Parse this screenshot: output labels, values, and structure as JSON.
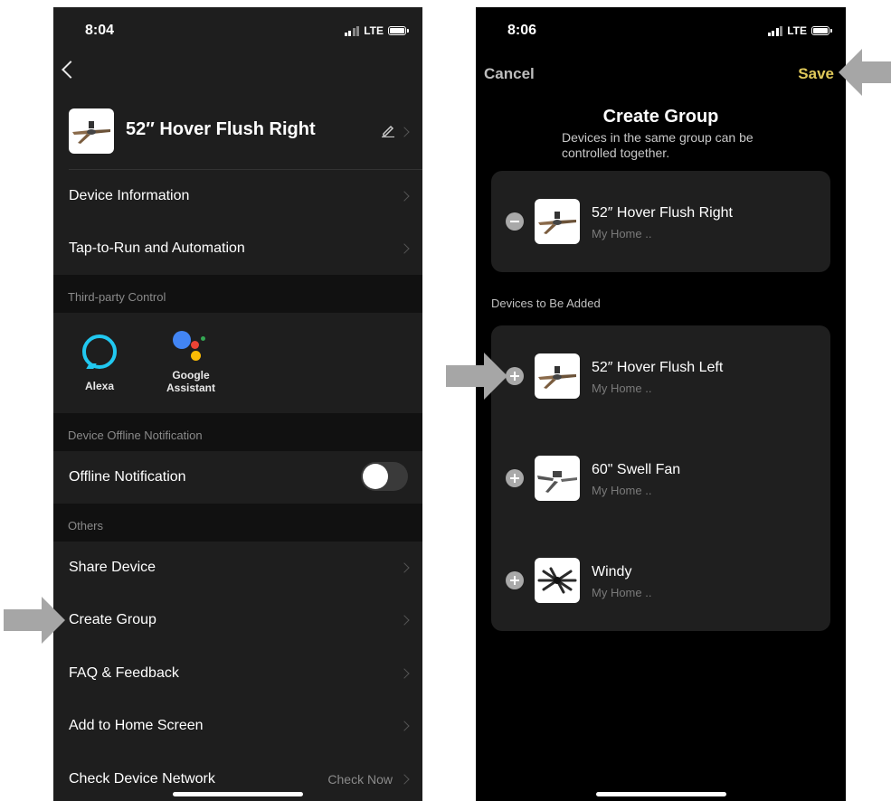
{
  "left": {
    "status": {
      "time": "8:04",
      "network": "LTE"
    },
    "device": {
      "title": "52″ Hover Flush Right"
    },
    "rows": {
      "device_information": "Device Information",
      "tap_to_run": "Tap-to-Run and Automation",
      "offline_notification": "Offline Notification",
      "share_device": "Share Device",
      "create_group": "Create Group",
      "faq": "FAQ & Feedback",
      "add_home": "Add to Home Screen",
      "check_network": "Check Device Network",
      "check_network_value": "Check Now"
    },
    "sections": {
      "third_party": "Third-party Control",
      "offline": "Device Offline Notification",
      "others": "Others"
    },
    "third_party": {
      "alexa": "Alexa",
      "google_line1": "Google",
      "google_line2": "Assistant"
    },
    "offline_toggle_on": false
  },
  "right": {
    "status": {
      "time": "8:06",
      "network": "LTE"
    },
    "nav": {
      "cancel": "Cancel",
      "save": "Save"
    },
    "title": "Create Group",
    "subtitle": "Devices in the same group can be controlled together.",
    "in_group": [
      {
        "name": "52″ Hover Flush Right",
        "location": "My Home .."
      }
    ],
    "to_add_label": "Devices to Be Added",
    "to_add": [
      {
        "name": "52″ Hover Flush Left",
        "location": "My Home .."
      },
      {
        "name": "60\" Swell Fan",
        "location": "My Home .."
      },
      {
        "name": "Windy",
        "location": "My Home .."
      }
    ]
  },
  "colors": {
    "save_accent": "#e0c95a",
    "alexa": "#21c8f0",
    "google_blue": "#4285f4",
    "google_red": "#ea4335",
    "google_yellow": "#fbbc05",
    "google_green": "#34a853"
  },
  "icons": [
    "back-chevron-icon",
    "edit-pencil-icon",
    "chevron-right-icon",
    "alexa-icon",
    "google-assistant-icon",
    "remove-circle-icon",
    "add-circle-icon",
    "pointer-arrow-icon"
  ]
}
